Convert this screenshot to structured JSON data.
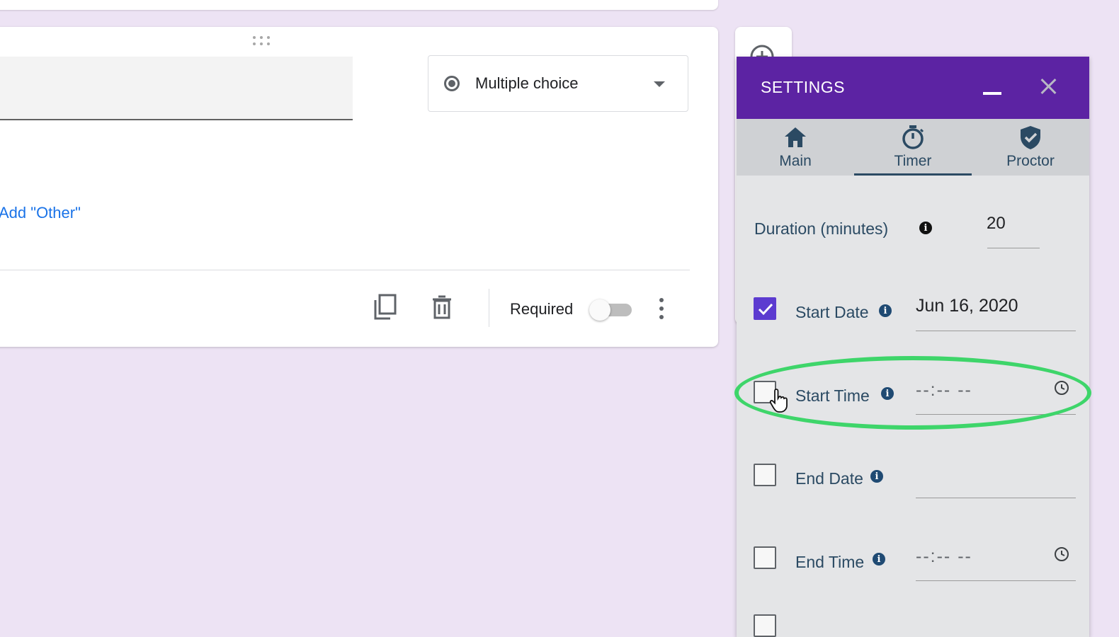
{
  "question_card": {
    "type_select": {
      "selected": "Multiple choice",
      "icon": "radio-button-icon"
    },
    "add_other_label": "Add \"Other\"",
    "footer": {
      "duplicate_icon": "copy-icon",
      "delete_icon": "trash-icon",
      "required_label": "Required",
      "required_on": false,
      "more_icon": "more-vert-icon"
    }
  },
  "side_toolbar": {
    "add_icon": "add-circle-icon"
  },
  "settings": {
    "title": "SETTINGS",
    "accent_color": "#5c23a3",
    "tabs": [
      {
        "label": "Main",
        "icon": "home-icon",
        "active": false
      },
      {
        "label": "Timer",
        "icon": "stopwatch-icon",
        "active": true
      },
      {
        "label": "Proctor",
        "icon": "shield-check-icon",
        "active": false
      }
    ],
    "duration": {
      "label": "Duration (minutes)",
      "value": "20"
    },
    "start_date": {
      "label": "Start Date",
      "checked": true,
      "value": "Jun 16, 2020"
    },
    "start_time": {
      "label": "Start Time",
      "checked": false,
      "value": "--:-- --"
    },
    "end_date": {
      "label": "End Date",
      "checked": false,
      "value": ""
    },
    "end_time": {
      "label": "End Time",
      "checked": false,
      "value": "--:-- --"
    }
  },
  "annotation": {
    "highlight_color": "#3ed56a"
  }
}
